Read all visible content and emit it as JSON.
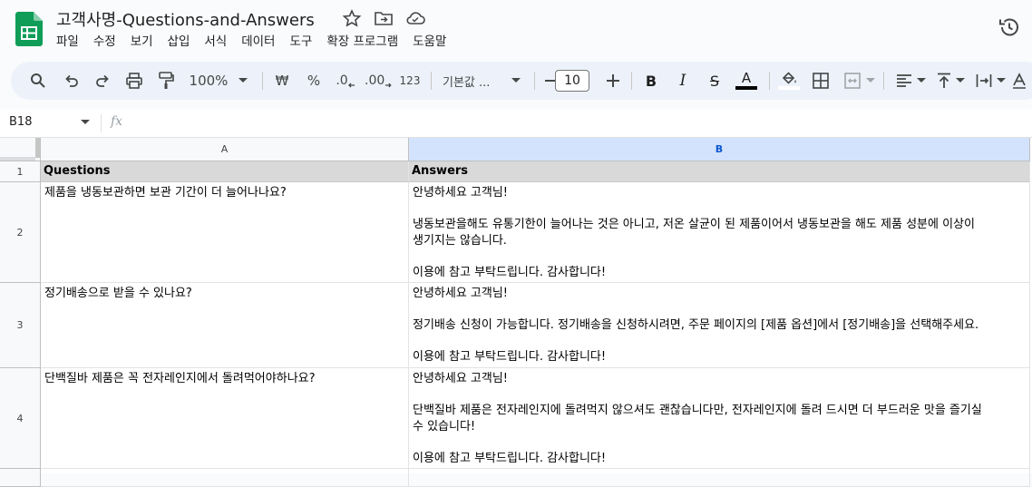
{
  "app": {
    "title": "고객사명-Questions-and-Answers",
    "menu": [
      "파일",
      "수정",
      "보기",
      "삽입",
      "서식",
      "데이터",
      "도구",
      "확장 프로그램",
      "도움말"
    ]
  },
  "toolbar": {
    "zoom": "100%",
    "currency": "₩",
    "percent": "%",
    "dec_decrease": ".0",
    "dec_increase": ".00",
    "number_format": "123",
    "font": "기본값 ...",
    "font_size": "10",
    "bold": "B",
    "italic": "I",
    "strike": "S",
    "text_color_letter": "A"
  },
  "formula_bar": {
    "cell_ref": "B18",
    "fx_label": "fx"
  },
  "sheet": {
    "columns": [
      "A",
      "B"
    ],
    "rows": [
      {
        "num": "1",
        "a": "Questions",
        "b": "Answers"
      },
      {
        "num": "2",
        "a": "제품을 냉동보관하면 보관 기간이 더 늘어나나요?",
        "b": "안녕하세요 고객님!\n\n냉동보관을해도 유통기한이 늘어나는 것은 아니고, 저온 살균이 된 제품이어서 냉동보관을 해도 제품 성분에 이상이\n생기지는 않습니다.\n\n이용에 참고 부탁드립니다. 감사합니다!"
      },
      {
        "num": "3",
        "a": "정기배송으로 받을 수 있나요?",
        "b": "안녕하세요 고객님!\n\n정기배송 신청이 가능합니다. 정기배송을 신청하시려면, 주문 페이지의 [제품 옵션]에서 [정기배송]을 선택해주세요.\n\n이용에 참고 부탁드립니다. 감사합니다!"
      },
      {
        "num": "4",
        "a": "단백질바 제품은 꼭 전자레인지에서 돌려먹어야하나요?",
        "b": "안녕하세요 고객님!\n\n단백질바 제품은 전자레인지에 돌려먹지 않으셔도 괜찮습니다만, 전자레인지에 돌려 드시면 더 부드러운 맛을 즐기실\n수 있습니다!\n\n이용에 참고 부탁드립니다. 감사합니다!"
      }
    ]
  }
}
